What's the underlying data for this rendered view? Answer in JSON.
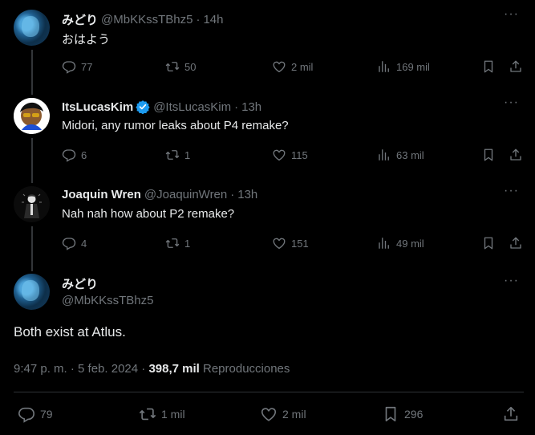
{
  "tweets": [
    {
      "name": "みどり",
      "handle": "@MbKKssTBhz5",
      "time": "14h",
      "text": "おはよう",
      "replies": "77",
      "retweets": "50",
      "likes": "2 mil",
      "views": "169 mil"
    },
    {
      "name": "ItsLucasKim",
      "handle": "@ItsLucasKim",
      "time": "13h",
      "text": "Midori, any rumor leaks about P4 remake?",
      "replies": "6",
      "retweets": "1",
      "likes": "115",
      "views": "63 mil"
    },
    {
      "name": "Joaquin Wren",
      "handle": "@JoaquinWren",
      "time": "13h",
      "text": "Nah nah how about P2 remake?",
      "replies": "4",
      "retweets": "1",
      "likes": "151",
      "views": "49 mil"
    }
  ],
  "main": {
    "name": "みどり",
    "handle": "@MbKKssTBhz5",
    "text": "Both exist at Atlus.",
    "timestamp": "9:47 p. m. · 5 feb. 2024 ·",
    "views_count": "398,7 mil",
    "views_label": "Reproducciones",
    "replies": "79",
    "retweets": "1 mil",
    "likes": "2 mil",
    "bookmarks": "296"
  },
  "separator": "·",
  "more_glyph": "···",
  "colors": {
    "background": "#000000",
    "text": "#e7e9ea",
    "muted": "#71767b",
    "verified": "#1d9bf0",
    "line": "#333639"
  },
  "icons": [
    "reply-icon",
    "retweet-icon",
    "like-icon",
    "views-icon",
    "bookmark-icon",
    "share-icon",
    "more-icon",
    "verified-badge-icon"
  ]
}
